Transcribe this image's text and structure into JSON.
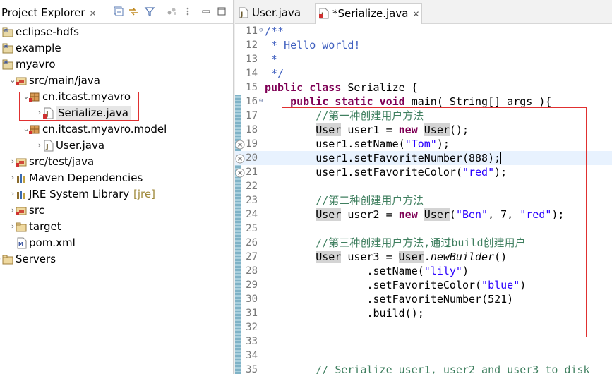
{
  "explorer": {
    "tab_label": "Project Explorer",
    "tab_close": "✕",
    "toolbar_icons": [
      "collapse-all-icon",
      "link-with-editor-icon",
      "filter-icon",
      "view-menu-icon",
      "minimize-icon",
      "maximize-icon"
    ],
    "tree": [
      {
        "label": "eclipse-hdfs",
        "icon": "project-icon",
        "depth": 0,
        "twisty": "",
        "deco": ""
      },
      {
        "label": "example",
        "icon": "project-icon",
        "depth": 0,
        "twisty": "",
        "deco": ""
      },
      {
        "label": "myavro",
        "icon": "project-icon",
        "depth": 0,
        "twisty": "",
        "deco": ""
      },
      {
        "label": "src/main/java",
        "icon": "source-folder-icon",
        "depth": 1,
        "twisty": "⌄",
        "deco": ""
      },
      {
        "label": "cn.itcast.myavro",
        "icon": "package-icon",
        "depth": 2,
        "twisty": "⌄",
        "deco": ""
      },
      {
        "label": "Serialize.java",
        "icon": "java-file-error-icon",
        "depth": 3,
        "twisty": "›",
        "deco": ""
      },
      {
        "label": "cn.itcast.myavro.model",
        "icon": "package-icon",
        "depth": 2,
        "twisty": "⌄",
        "deco": ""
      },
      {
        "label": "User.java",
        "icon": "java-file-icon",
        "depth": 3,
        "twisty": "›",
        "deco": ""
      },
      {
        "label": "src/test/java",
        "icon": "source-folder-icon",
        "depth": 1,
        "twisty": "›",
        "deco": ""
      },
      {
        "label": "Maven Dependencies",
        "icon": "library-icon",
        "depth": 1,
        "twisty": "›",
        "deco": ""
      },
      {
        "label": "JRE System Library",
        "icon": "library-icon",
        "depth": 1,
        "twisty": "›",
        "deco": "[jre]"
      },
      {
        "label": "src",
        "icon": "source-folder-icon",
        "depth": 1,
        "twisty": "›",
        "deco": ""
      },
      {
        "label": "target",
        "icon": "folder-icon",
        "depth": 1,
        "twisty": "›",
        "deco": ""
      },
      {
        "label": "pom.xml",
        "icon": "xml-file-icon",
        "depth": 1,
        "twisty": "",
        "deco": ""
      },
      {
        "label": "Servers",
        "icon": "folder-icon",
        "depth": 0,
        "twisty": "›",
        "deco": ""
      }
    ]
  },
  "editor": {
    "tabs": [
      {
        "label": "User.java",
        "active": false
      },
      {
        "label": "*Serialize.java",
        "active": true
      }
    ],
    "tab_close": "✕",
    "lines": [
      {
        "n": "11",
        "fold": "⊖",
        "err": false,
        "text": "/**"
      },
      {
        "n": "12",
        "fold": "",
        "err": false,
        "text": " * Hello world!"
      },
      {
        "n": "13",
        "fold": "",
        "err": false,
        "text": " *"
      },
      {
        "n": "14",
        "fold": "",
        "err": false,
        "text": " */"
      },
      {
        "n": "15",
        "fold": "",
        "err": false,
        "text": "public class Serialize {"
      },
      {
        "n": "16",
        "fold": "⊖",
        "err": false,
        "text": "    public static void main( String[] args ){"
      },
      {
        "n": "17",
        "fold": "",
        "err": false,
        "text": "        //第一种创建用户方法"
      },
      {
        "n": "18",
        "fold": "",
        "err": false,
        "text": "        User user1 = new User();"
      },
      {
        "n": "19",
        "fold": "",
        "err": true,
        "text": "        user1.setName(\"Tom\");"
      },
      {
        "n": "20",
        "fold": "",
        "err": true,
        "text": "        user1.setFavoriteNumber(888);"
      },
      {
        "n": "21",
        "fold": "",
        "err": true,
        "text": "        user1.setFavoriteColor(\"red\");"
      },
      {
        "n": "22",
        "fold": "",
        "err": false,
        "text": ""
      },
      {
        "n": "23",
        "fold": "",
        "err": false,
        "text": "        //第二种创建用户方法"
      },
      {
        "n": "24",
        "fold": "",
        "err": false,
        "text": "        User user2 = new User(\"Ben\", 7, \"red\");"
      },
      {
        "n": "25",
        "fold": "",
        "err": false,
        "text": ""
      },
      {
        "n": "26",
        "fold": "",
        "err": false,
        "text": "        //第三种创建用户方法,通过build创建用户"
      },
      {
        "n": "27",
        "fold": "",
        "err": false,
        "text": "        User user3 = User.newBuilder()"
      },
      {
        "n": "28",
        "fold": "",
        "err": false,
        "text": "                .setName(\"lily\")"
      },
      {
        "n": "29",
        "fold": "",
        "err": false,
        "text": "                .setFavoriteColor(\"blue\")"
      },
      {
        "n": "30",
        "fold": "",
        "err": false,
        "text": "                .setFavoriteNumber(521)"
      },
      {
        "n": "31",
        "fold": "",
        "err": false,
        "text": "                .build();"
      },
      {
        "n": "32",
        "fold": "",
        "err": false,
        "text": ""
      },
      {
        "n": "33",
        "fold": "",
        "err": false,
        "text": ""
      },
      {
        "n": "34",
        "fold": "",
        "err": false,
        "text": ""
      },
      {
        "n": "35",
        "fold": "",
        "err": false,
        "text": "        // Serialize user1, user2 and user3 to disk"
      }
    ],
    "current_line": "20"
  },
  "colors": {
    "keyword": "#7f0055",
    "comment": "#3f7f5f",
    "javadoc": "#3f5fbf",
    "string": "#2a00ff",
    "annotation_box": "#e03030",
    "current_line": "#e8f2fe"
  }
}
